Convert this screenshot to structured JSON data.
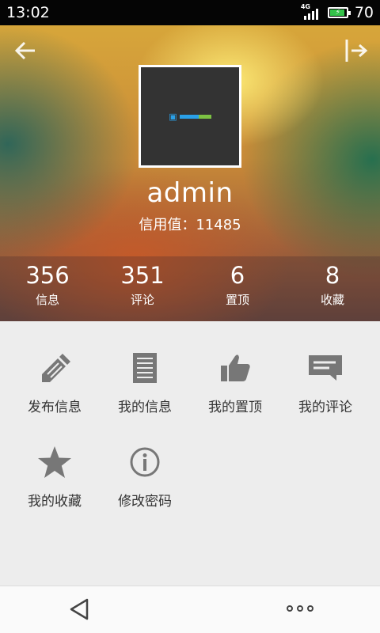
{
  "status_bar": {
    "time": "13:02",
    "network": "4G",
    "battery_level": "70"
  },
  "header": {
    "back_icon": "arrow-left-icon",
    "logout_icon": "logout-icon",
    "username": "admin",
    "credit_text": "信用值：11485"
  },
  "stats": [
    {
      "value": "356",
      "label": "信息"
    },
    {
      "value": "351",
      "label": "评论"
    },
    {
      "value": "6",
      "label": "置顶"
    },
    {
      "value": "8",
      "label": "收藏"
    }
  ],
  "menu": [
    {
      "label": "发布信息",
      "icon": "pencil-icon"
    },
    {
      "label": "我的信息",
      "icon": "document-icon"
    },
    {
      "label": "我的置顶",
      "icon": "thumbs-up-icon"
    },
    {
      "label": "我的评论",
      "icon": "comment-icon"
    },
    {
      "label": "我的收藏",
      "icon": "star-icon"
    },
    {
      "label": "修改密码",
      "icon": "info-icon"
    }
  ],
  "colors": {
    "icon_gray": "#777777",
    "menu_background": "#ededed",
    "battery_green": "#34c24a"
  }
}
